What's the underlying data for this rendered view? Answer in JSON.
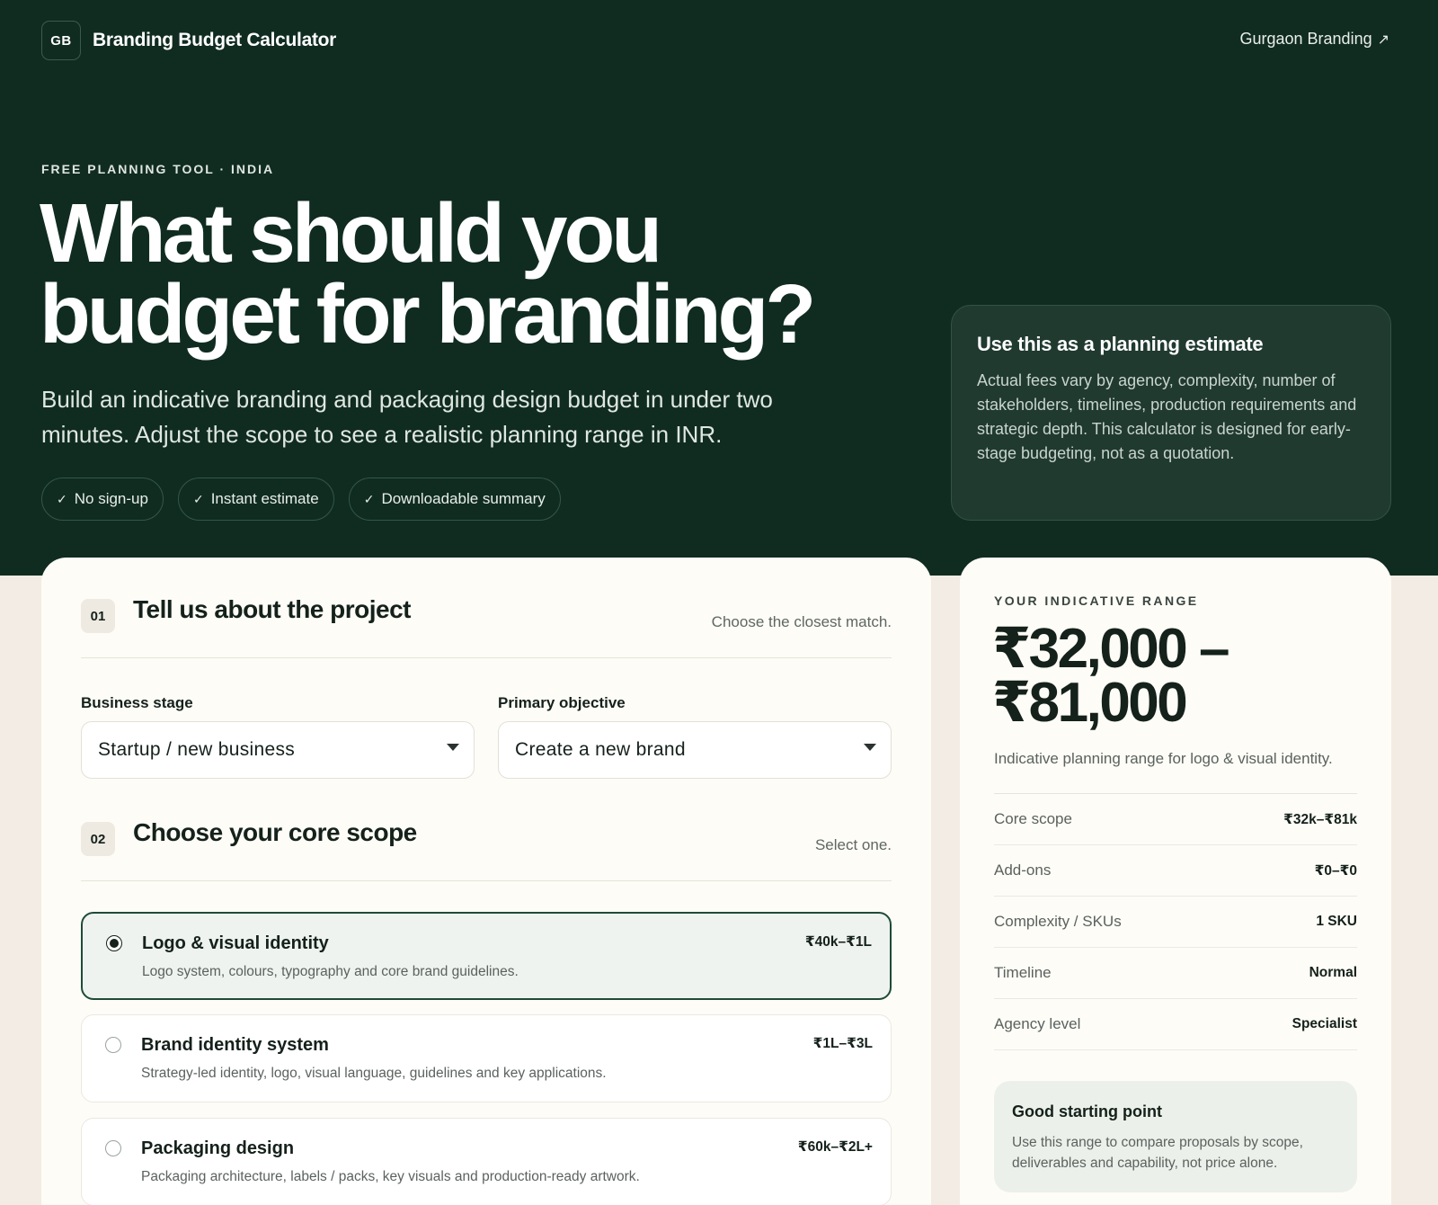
{
  "header": {
    "badge": "GB",
    "title": "Branding Budget Calculator",
    "link_label": "Gurgaon Branding",
    "link_icon": "external-arrow-icon"
  },
  "hero": {
    "eyebrow": "FREE PLANNING TOOL · INDIA",
    "headline_line1": "What should you",
    "headline_line2": "budget for branding?",
    "lede": "Build an indicative branding and packaging design budget in under two minutes. Adjust the scope to see a realistic planning range in INR.",
    "pills": [
      "No sign-up",
      "Instant estimate",
      "Downloadable summary"
    ]
  },
  "note": {
    "title": "Use this as a planning estimate",
    "body": "Actual fees vary by agency, complexity, number of stakeholders, timelines, production requirements and strategic depth. This calculator is designed for early-stage budgeting, not as a quotation."
  },
  "section1": {
    "step": "01",
    "title": "Tell us about the project",
    "hint": "Choose the closest match.",
    "business_stage_label": "Business stage",
    "business_stage_value": "Startup / new business",
    "objective_label": "Primary objective",
    "objective_value": "Create a new brand"
  },
  "section2": {
    "step": "02",
    "title": "Choose your core scope",
    "hint": "Select one.",
    "options": [
      {
        "title": "Logo & visual identity",
        "desc": "Logo system, colours, typography and core brand guidelines.",
        "price": "₹40k–₹1L",
        "selected": true
      },
      {
        "title": "Brand identity system",
        "desc": "Strategy-led identity, logo, visual language, guidelines and key applications.",
        "price": "₹1L–₹3L",
        "selected": false
      },
      {
        "title": "Packaging design",
        "desc": "Packaging architecture, labels / packs, key visuals and production-ready artwork.",
        "price": "₹60k–₹2L+",
        "selected": false
      }
    ]
  },
  "range": {
    "eyebrow": "YOUR INDICATIVE RANGE",
    "value_line1": "₹32,000 –",
    "value_line2": "₹81,000",
    "caption": "Indicative planning range for logo & visual identity.",
    "breakdown": [
      {
        "label": "Core scope",
        "value": "₹32k–₹81k"
      },
      {
        "label": "Add-ons",
        "value": "₹0–₹0"
      },
      {
        "label": "Complexity / SKUs",
        "value": "1 SKU"
      },
      {
        "label": "Timeline",
        "value": "Normal"
      },
      {
        "label": "Agency level",
        "value": "Specialist"
      }
    ],
    "tip_title": "Good starting point",
    "tip_body": "Use this range to compare proposals by scope, deliverables and capability, not price alone."
  },
  "colors": {
    "hero_bg": "#102c21",
    "page_bg": "#f3ece4",
    "accent": "#1f4a38"
  }
}
